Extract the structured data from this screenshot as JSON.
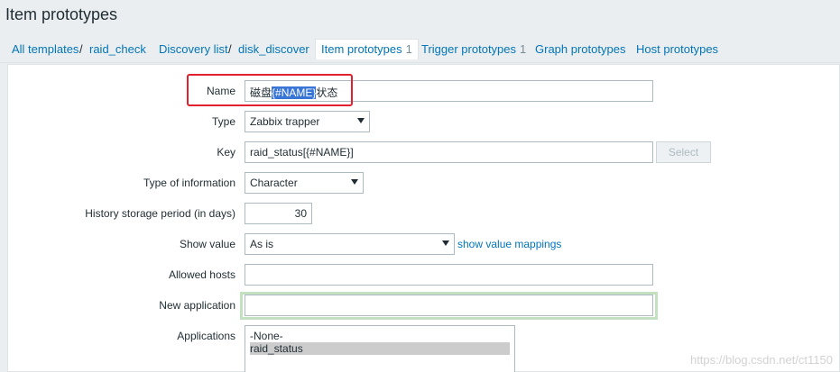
{
  "page": {
    "title": "Item prototypes"
  },
  "nav": {
    "breadcrumb_all_templates": "All templates",
    "sep": "/",
    "breadcrumb_template": "raid_check",
    "discovery_list": "Discovery list",
    "discovery_rule": "disk_discover",
    "tab_item_prototypes": "Item prototypes",
    "tab_item_prototypes_count": "1",
    "tab_trigger_prototypes": "Trigger prototypes",
    "tab_trigger_prototypes_count": "1",
    "tab_graph_prototypes": "Graph prototypes",
    "tab_host_prototypes": "Host prototypes"
  },
  "form": {
    "name": {
      "label": "Name",
      "value_prefix": "磁盘",
      "value_selected": "{#NAME}",
      "value_suffix": "状态"
    },
    "type": {
      "label": "Type",
      "value": "Zabbix trapper"
    },
    "key": {
      "label": "Key",
      "value": "raid_status[{#NAME}]",
      "select_button": "Select"
    },
    "type_of_information": {
      "label": "Type of information",
      "value": "Character"
    },
    "history": {
      "label": "History storage period (in days)",
      "value": "30"
    },
    "show_value": {
      "label": "Show value",
      "value": "As is",
      "link": "show value mappings"
    },
    "allowed_hosts": {
      "label": "Allowed hosts",
      "value": ""
    },
    "new_application": {
      "label": "New application",
      "value": ""
    },
    "applications": {
      "label": "Applications",
      "options": [
        "-None-",
        "raid_status"
      ],
      "selected": "raid_status"
    }
  },
  "watermark": "https://blog.csdn.net/ct1150",
  "colors": {
    "link": "#0275b8",
    "highlight": "#3875d7",
    "annotation_box": "#e5202e",
    "focus_glow": "#c3e0c0"
  }
}
